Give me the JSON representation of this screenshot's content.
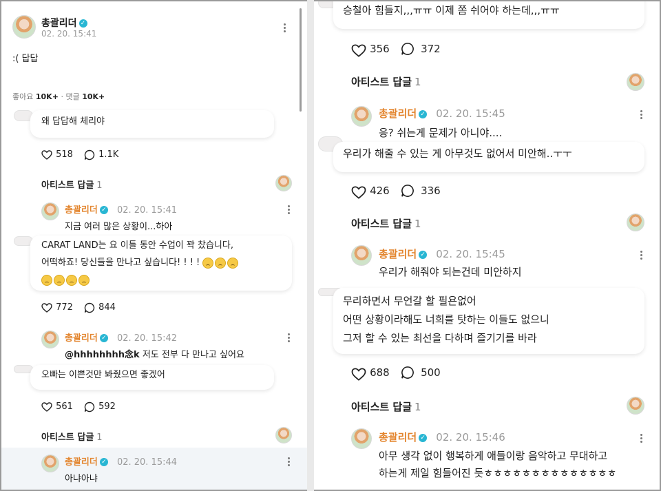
{
  "left": {
    "post": {
      "author": "총괄리더",
      "timestamp": "02. 20. 15:41",
      "body": ":( 답답",
      "likes_label": "좋아요",
      "likes": "10K+",
      "sep": "·",
      "comments_label": "댓글",
      "comments": "10K+"
    },
    "thread1": {
      "fan_comment": "왜 답답해 체리야",
      "likes": "518",
      "comments": "1.1K",
      "artist_reply_label": "아티스트 답글",
      "artist_reply_count": "1",
      "reply": {
        "author": "총괄리더",
        "timestamp": "02. 20. 15:41",
        "text": "지금 여러 많은 상황이...하아"
      }
    },
    "thread2": {
      "fan_comment_line1": "CARAT LAND는 요 이틀 동안 수업이 꽉 찼습니다,",
      "fan_comment_line2": "어떡하죠! 당신들을 만나고 싶습니다! ! ! !",
      "likes": "772",
      "comments": "844",
      "reply": {
        "author": "총괄리더",
        "timestamp": "02. 20. 15:42",
        "mention": "@hhhhhhhh念k",
        "text": " 저도 전부 다 만나고 싶어요"
      }
    },
    "thread3": {
      "fan_comment": "오빠는 이쁜것만 봐줬으면 좋겠어",
      "likes": "561",
      "comments": "592",
      "artist_reply_label": "아티스트 답글",
      "artist_reply_count": "1",
      "reply": {
        "author": "총괄리더",
        "timestamp": "02. 20. 15:44",
        "text": "아냐아냐"
      }
    }
  },
  "right": {
    "thread1": {
      "fan_comment": "승철아 힘들지,,,ㅠㅠ 이제 쫌 쉬어야 하는데,,,ㅠㅠ",
      "likes": "356",
      "comments": "372",
      "artist_reply_label": "아티스트 답글",
      "artist_reply_count": "1",
      "reply": {
        "author": "총괄리더",
        "timestamp": "02. 20. 15:45",
        "text": "응? 쉬는게 문제가 아니야...."
      }
    },
    "thread2": {
      "fan_comment": "우리가 해줄 수 있는 게 아무것도 없어서 미안해..ㅜㅜ",
      "likes": "426",
      "comments": "336",
      "artist_reply_label": "아티스트 답글",
      "artist_reply_count": "1",
      "reply": {
        "author": "총괄리더",
        "timestamp": "02. 20. 15:45",
        "text": "우리가 해줘야 되는건데 미안하지"
      }
    },
    "thread3": {
      "fan_comment_line1": "무리하면서 무언갈 할 필욘없어",
      "fan_comment_line2": "어떤 상황이라해도 너희를 탓하는 이들도 없으니",
      "fan_comment_line3": "그저 할 수 있는 최선을 다하며 즐기기를 바라",
      "likes": "688",
      "comments": "500",
      "artist_reply_label": "아티스트 답글",
      "artist_reply_count": "1",
      "reply": {
        "author": "총괄리더",
        "timestamp": "02. 20. 15:46",
        "text_line1": "아무 생각 없이 행복하게 애들이랑 음악하고 무대하고",
        "text_line2": "하는게 제일 힘들어진 듯ㅎㅎㅎㅎㅎㅎㅎㅎㅎㅎㅎㅎㅎㅎ"
      }
    }
  },
  "colors": {
    "artist_name": "#e3852e",
    "verified": "#28b6d3",
    "time": "#9a9a9a"
  },
  "icons": [
    "heart-icon",
    "comment-icon",
    "more-icon",
    "verified-icon",
    "crying-emoji"
  ]
}
